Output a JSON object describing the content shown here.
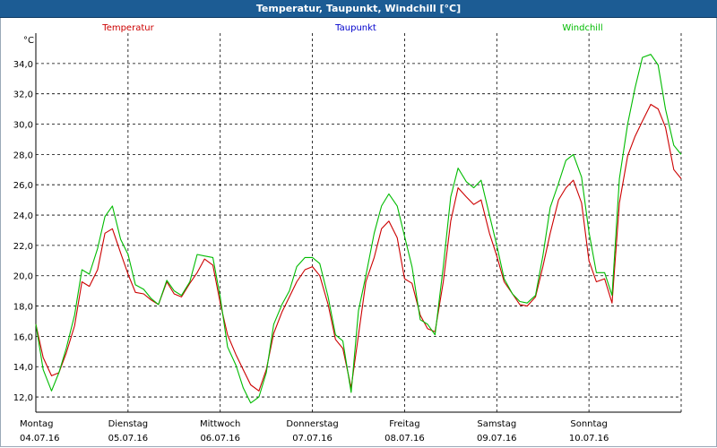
{
  "window": {
    "title": "Temperatur, Taupunkt, Windchill [°C]"
  },
  "chart_data": {
    "type": "line",
    "title": "Temperatur, Taupunkt, Windchill [°C]",
    "ylabel": "°C",
    "ylim": [
      11,
      36
    ],
    "yticks": [
      12,
      14,
      16,
      18,
      20,
      22,
      24,
      26,
      28,
      30,
      32,
      34
    ],
    "ytick_labels": [
      "12,0",
      "14,0",
      "16,0",
      "18,0",
      "20,0",
      "22,0",
      "24,0",
      "26,0",
      "28,0",
      "30,0",
      "32,0",
      "34,0"
    ],
    "xlim": [
      0,
      7
    ],
    "x_units": "days since start of 04.07.16 (Montag)",
    "xticks": [
      {
        "x": 0,
        "day": "Montag",
        "date": "04.07.16"
      },
      {
        "x": 1,
        "day": "Dienstag",
        "date": "05.07.16"
      },
      {
        "x": 2,
        "day": "Mittwoch",
        "date": "06.07.16"
      },
      {
        "x": 3,
        "day": "Donnerstag",
        "date": "07.07.16"
      },
      {
        "x": 4,
        "day": "Freitag",
        "date": "08.07.16"
      },
      {
        "x": 5,
        "day": "Samstag",
        "date": "09.07.16"
      },
      {
        "x": 6,
        "day": "Sonntag",
        "date": "10.07.16"
      }
    ],
    "grid": true,
    "legend": [
      {
        "name": "Temperatur",
        "color": "#cc0000"
      },
      {
        "name": "Taupunkt",
        "color": "#0000cc"
      },
      {
        "name": "Windchill",
        "color": "#00bb00"
      }
    ],
    "series": [
      {
        "name": "Temperatur",
        "color": "#cc0000",
        "x": [
          0.0,
          0.08,
          0.17,
          0.25,
          0.33,
          0.42,
          0.5,
          0.58,
          0.67,
          0.75,
          0.83,
          0.92,
          1.0,
          1.08,
          1.17,
          1.25,
          1.33,
          1.42,
          1.5,
          1.58,
          1.67,
          1.75,
          1.83,
          1.92,
          2.0,
          2.08,
          2.17,
          2.25,
          2.33,
          2.42,
          2.5,
          2.58,
          2.67,
          2.75,
          2.83,
          2.92,
          3.0,
          3.08,
          3.17,
          3.25,
          3.33,
          3.42,
          3.5,
          3.58,
          3.67,
          3.75,
          3.83,
          3.92,
          4.0,
          4.08,
          4.17,
          4.25,
          4.33,
          4.42,
          4.5,
          4.58,
          4.67,
          4.75,
          4.83,
          4.92,
          5.0,
          5.08,
          5.17,
          5.25,
          5.33,
          5.42,
          5.5,
          5.58,
          5.67,
          5.75,
          5.83,
          5.92,
          6.0,
          6.08,
          6.17,
          6.25,
          6.33,
          6.42,
          6.5,
          6.58,
          6.67,
          6.75,
          6.83,
          6.92,
          7.0
        ],
        "values": [
          16.8,
          14.6,
          13.4,
          13.6,
          14.9,
          16.7,
          19.6,
          19.3,
          20.4,
          22.8,
          23.1,
          21.5,
          20.1,
          18.9,
          18.8,
          18.4,
          18.1,
          19.6,
          18.8,
          18.6,
          19.5,
          20.2,
          21.1,
          20.7,
          18.2,
          16.1,
          14.8,
          13.8,
          12.8,
          12.4,
          13.8,
          16.2,
          17.6,
          18.6,
          19.6,
          20.4,
          20.6,
          20.0,
          18.1,
          15.8,
          15.2,
          12.6,
          16.1,
          19.6,
          21.2,
          23.1,
          23.6,
          22.5,
          19.8,
          19.5,
          17.4,
          16.5,
          16.3,
          19.6,
          23.6,
          25.8,
          25.2,
          24.7,
          25.0,
          22.8,
          21.3,
          19.6,
          18.8,
          18.1,
          18.0,
          18.6,
          20.6,
          22.8,
          25.0,
          25.8,
          26.3,
          24.8,
          21.0,
          19.6,
          19.8,
          18.2,
          24.8,
          27.9,
          29.2,
          30.2,
          31.3,
          31.0,
          29.8,
          27.0,
          26.4
        ]
      },
      {
        "name": "Windchill",
        "color": "#00bb00",
        "x": [
          0.0,
          0.08,
          0.17,
          0.25,
          0.33,
          0.42,
          0.5,
          0.58,
          0.67,
          0.75,
          0.83,
          0.92,
          1.0,
          1.08,
          1.17,
          1.25,
          1.33,
          1.42,
          1.5,
          1.58,
          1.67,
          1.75,
          1.83,
          1.92,
          2.0,
          2.08,
          2.17,
          2.25,
          2.33,
          2.42,
          2.5,
          2.58,
          2.67,
          2.75,
          2.83,
          2.92,
          3.0,
          3.08,
          3.17,
          3.25,
          3.33,
          3.42,
          3.5,
          3.58,
          3.67,
          3.75,
          3.83,
          3.92,
          4.0,
          4.08,
          4.17,
          4.25,
          4.33,
          4.42,
          4.5,
          4.58,
          4.67,
          4.75,
          4.83,
          4.92,
          5.0,
          5.08,
          5.17,
          5.25,
          5.33,
          5.42,
          5.5,
          5.58,
          5.67,
          5.75,
          5.83,
          5.92,
          6.0,
          6.08,
          6.17,
          6.25,
          6.33,
          6.42,
          6.5,
          6.58,
          6.67,
          6.75,
          6.83,
          6.92,
          7.0
        ],
        "values": [
          16.8,
          13.8,
          12.4,
          13.6,
          15.2,
          17.4,
          20.4,
          20.1,
          21.8,
          23.9,
          24.6,
          22.4,
          21.4,
          19.4,
          19.1,
          18.5,
          18.1,
          19.7,
          19.0,
          18.7,
          19.6,
          21.4,
          21.3,
          21.2,
          18.6,
          15.3,
          14.1,
          12.6,
          11.6,
          12.0,
          13.6,
          16.8,
          18.1,
          19.0,
          20.6,
          21.2,
          21.2,
          20.8,
          18.6,
          16.1,
          15.7,
          12.3,
          17.7,
          20.0,
          22.8,
          24.6,
          25.4,
          24.6,
          22.6,
          20.6,
          17.1,
          16.8,
          16.1,
          20.6,
          25.2,
          27.1,
          26.2,
          25.8,
          26.3,
          24.0,
          22.0,
          19.8,
          18.8,
          18.3,
          18.2,
          18.7,
          21.3,
          24.5,
          26.1,
          27.6,
          28.0,
          26.5,
          22.9,
          20.2,
          20.2,
          18.7,
          26.4,
          30.0,
          32.4,
          34.4,
          34.6,
          33.9,
          31.0,
          28.6,
          28.0
        ]
      }
    ]
  }
}
